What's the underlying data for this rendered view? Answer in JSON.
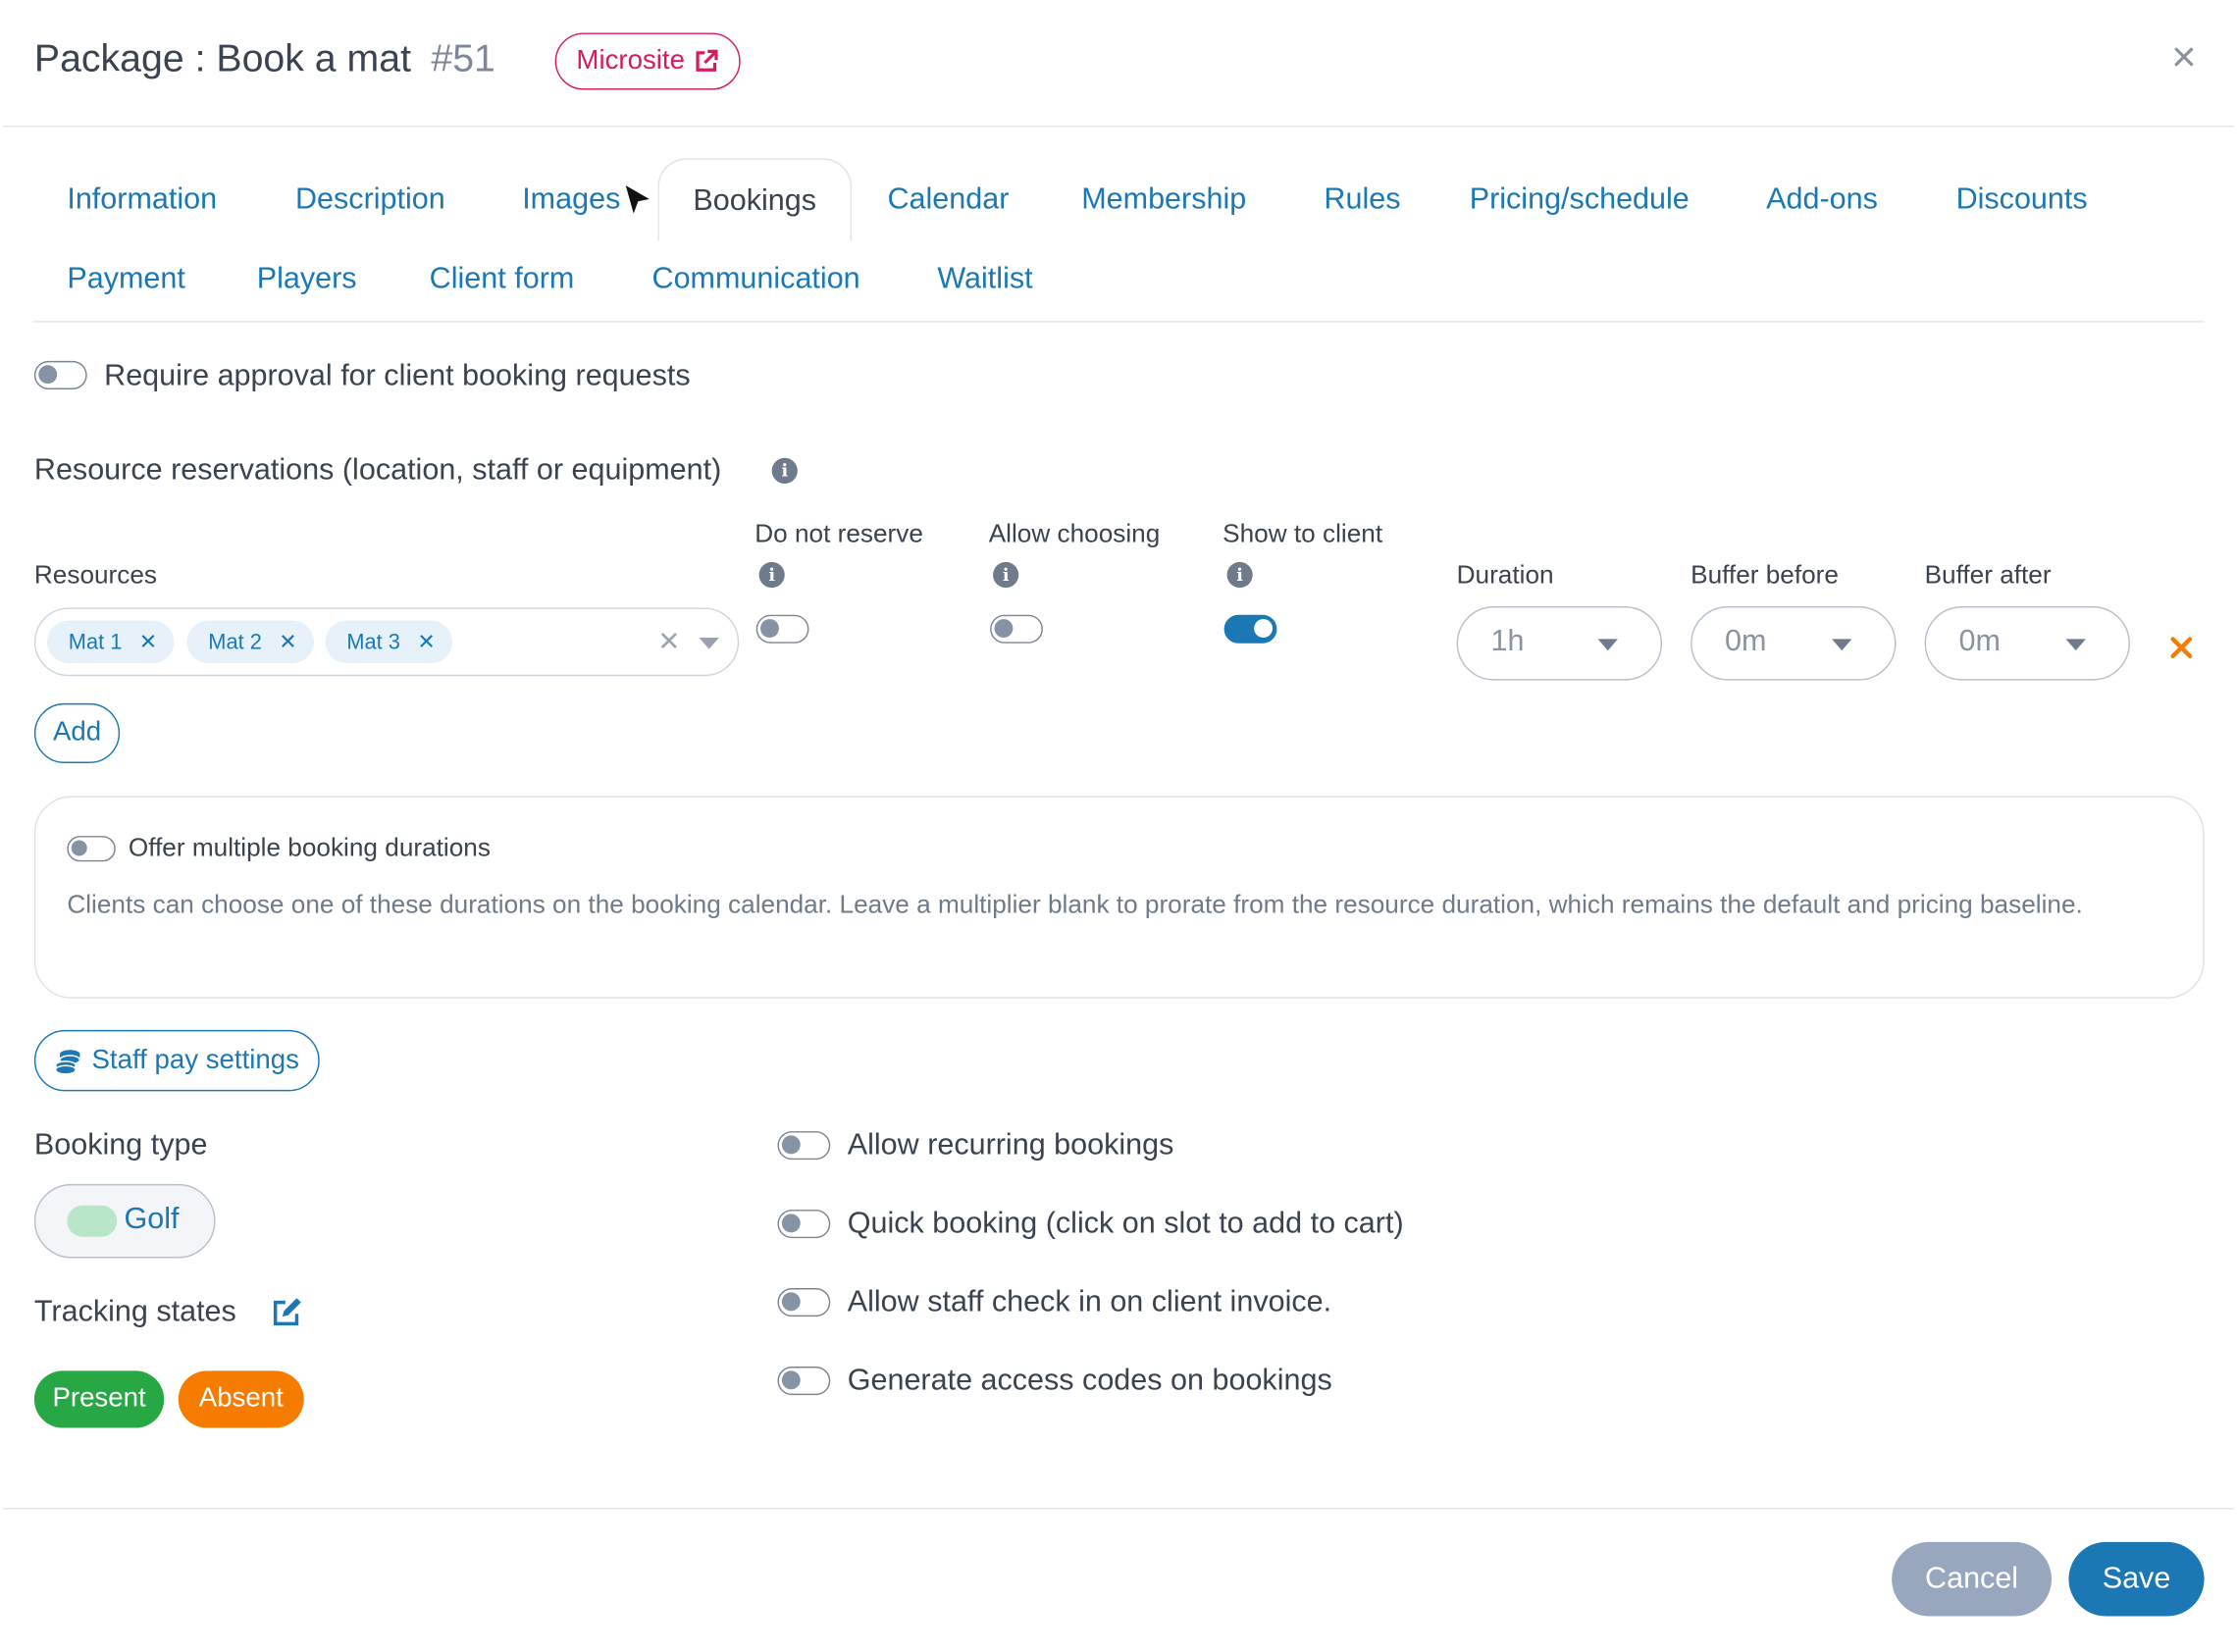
{
  "header": {
    "title": "Package : Book a mat",
    "package_id": "#51",
    "microsite_label": "Microsite",
    "close_label": "×"
  },
  "tabs": {
    "active": "Bookings",
    "row1": [
      "Information",
      "Description",
      "Images",
      "Bookings",
      "Calendar",
      "Membership",
      "Rules",
      "Pricing/schedule",
      "Add-ons",
      "Discounts"
    ],
    "row2": [
      "Payment",
      "Players",
      "Client form",
      "Communication",
      "Waitlist"
    ]
  },
  "approval": {
    "label": "Require approval for client booking requests",
    "enabled": false
  },
  "resources": {
    "section_title": "Resource reservations (location, staff or equipment)",
    "columns": {
      "resources": "Resources",
      "do_not_reserve": "Do not reserve",
      "allow_choosing": "Allow choosing",
      "show_to_client": "Show to client",
      "duration": "Duration",
      "buffer_before": "Buffer before",
      "buffer_after": "Buffer after"
    },
    "row": {
      "chips": [
        "Mat 1",
        "Mat 2",
        "Mat 3"
      ],
      "do_not_reserve": false,
      "allow_choosing": false,
      "show_to_client": true,
      "duration": "1h",
      "buffer_before": "0m",
      "buffer_after": "0m"
    },
    "add_label": "Add"
  },
  "durations": {
    "label": "Offer multiple booking durations",
    "enabled": false,
    "description": "Clients can choose one of these durations on the booking calendar. Leave a multiplier blank to prorate from the resource duration, which remains the default and pricing baseline."
  },
  "staff_pay_label": "Staff pay settings",
  "booking_type": {
    "label": "Booking type",
    "value": "Golf",
    "color": "#b9e6c9"
  },
  "tracking": {
    "label": "Tracking states",
    "states": [
      {
        "label": "Present",
        "color": "#27a844"
      },
      {
        "label": "Absent",
        "color": "#f57c00"
      }
    ]
  },
  "options": [
    {
      "label": "Allow recurring bookings",
      "enabled": false
    },
    {
      "label": "Quick booking (click on slot to add to cart)",
      "enabled": false
    },
    {
      "label": "Allow staff check in on client invoice.",
      "enabled": false
    },
    {
      "label": "Generate access codes on bookings",
      "enabled": false
    }
  ],
  "footer": {
    "cancel_label": "Cancel",
    "save_label": "Save"
  },
  "colors": {
    "accent": "#1b78b4",
    "brand_pink": "#d81b60",
    "cancel": "#98a6be",
    "remove": "#f57c00"
  }
}
